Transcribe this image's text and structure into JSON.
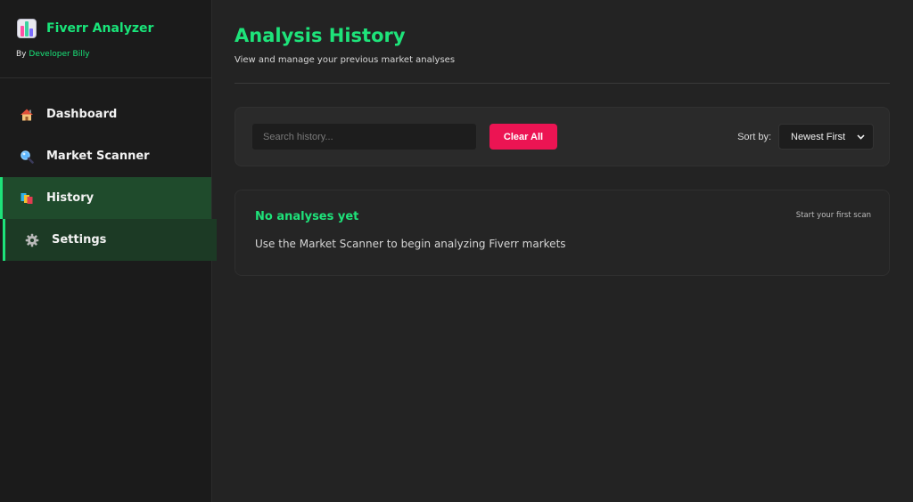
{
  "brand": {
    "title": "Fiverr Analyzer",
    "by_prefix": "By",
    "developer": "Developer Billy"
  },
  "sidebar": {
    "items": [
      {
        "label": "Dashboard",
        "icon": "house-icon"
      },
      {
        "label": "Market Scanner",
        "icon": "magnifier-icon"
      },
      {
        "label": "History",
        "icon": "books-icon",
        "active": true
      },
      {
        "label": "Settings",
        "icon": "gear-icon"
      }
    ]
  },
  "main": {
    "title": "Analysis History",
    "subtitle": "View and manage your previous market analyses"
  },
  "toolbar": {
    "search_placeholder": "Search history...",
    "clear_label": "Clear All",
    "sort_label": "Sort by:",
    "sort_value": "Newest First"
  },
  "empty_state": {
    "title": "No analyses yet",
    "hint": "Start your first scan",
    "description": "Use the Market Scanner to begin analyzing Fiverr markets"
  },
  "colors": {
    "accent": "#1ee37a",
    "danger": "#ec1453",
    "background": "#232323",
    "sidebar": "#1b1b1b"
  }
}
